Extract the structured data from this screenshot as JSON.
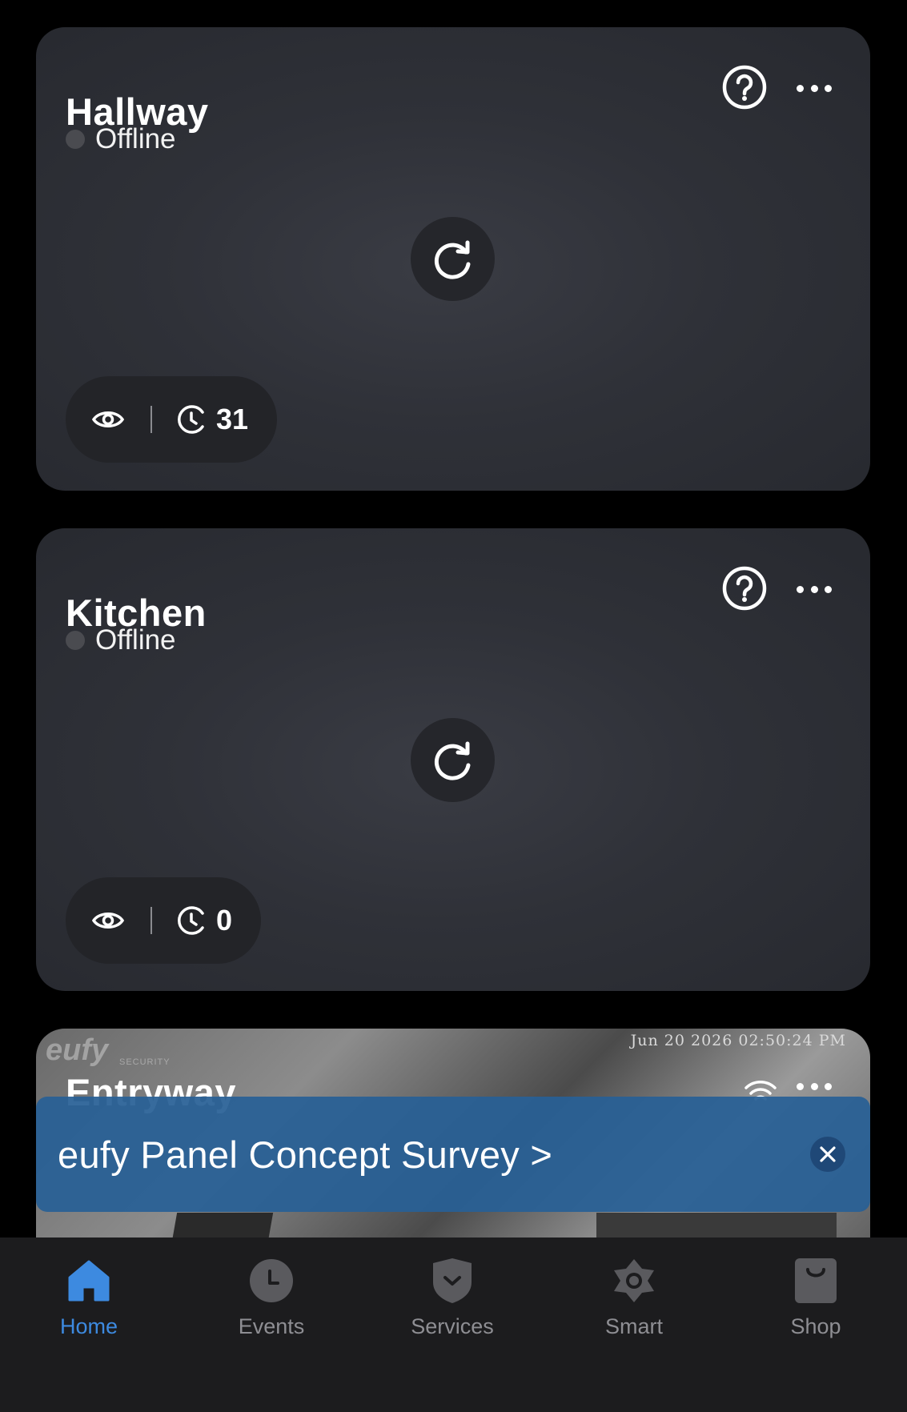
{
  "cameras": [
    {
      "name": "Hallway",
      "status": "Offline",
      "event_count": "31"
    },
    {
      "name": "Kitchen",
      "status": "Offline",
      "event_count": "0"
    },
    {
      "name": "Entryway",
      "timestamp": "Jun 20 2026   02:50:24 PM",
      "watermark": "eufy",
      "watermark_sub": "SECURITY"
    }
  ],
  "banner": {
    "text": "eufy Panel Concept Survey >"
  },
  "tabs": [
    {
      "label": "Home",
      "icon": "home-icon",
      "active": true
    },
    {
      "label": "Events",
      "icon": "clock-icon",
      "active": false
    },
    {
      "label": "Services",
      "icon": "shield-icon",
      "active": false
    },
    {
      "label": "Smart",
      "icon": "smart-icon",
      "active": false
    },
    {
      "label": "Shop",
      "icon": "shop-bag-icon",
      "active": false
    }
  ],
  "colors": {
    "accent": "#3d8ae0",
    "banner": "#2860a0",
    "card": "#2f3138"
  }
}
